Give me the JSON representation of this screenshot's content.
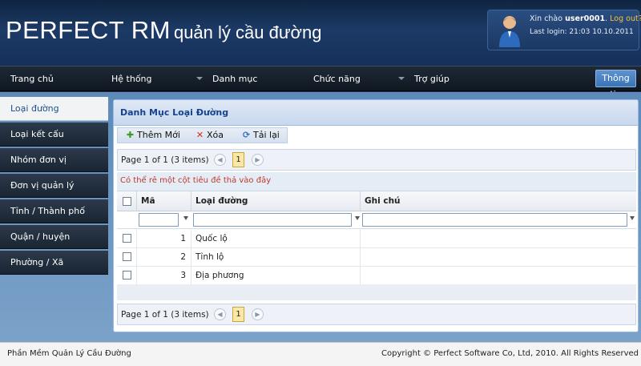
{
  "header": {
    "brand": "PERFECT RM",
    "subtitle": "quản lý cầu đường",
    "greeting": "Xin chào",
    "username": "user0001",
    "separator": ".",
    "logout": "Log out?",
    "last_login": "Last login: 21:03 10.10.2011"
  },
  "nav": {
    "items": [
      {
        "label": "Trang chủ",
        "has_dropdown": false
      },
      {
        "label": "Hệ thống",
        "has_dropdown": true
      },
      {
        "label": "Danh mục",
        "has_dropdown": false
      },
      {
        "label": "Chức năng",
        "has_dropdown": true
      },
      {
        "label": "Trợ giúp",
        "has_dropdown": false
      }
    ],
    "info_button": "Thông tin"
  },
  "sidebar": {
    "items": [
      {
        "label": "Loại đường",
        "active": true
      },
      {
        "label": "Loại kết cấu",
        "active": false
      },
      {
        "label": "Nhóm đơn vị",
        "active": false
      },
      {
        "label": "Đơn vị quản lý",
        "active": false
      },
      {
        "label": "Tỉnh / Thành phố",
        "active": false
      },
      {
        "label": "Quận / huyện",
        "active": false
      },
      {
        "label": "Phường / Xã",
        "active": false
      }
    ]
  },
  "panel": {
    "title": "Danh Mục Loại Đường",
    "toolbar": {
      "add": "Thêm Mới",
      "delete": "Xóa",
      "reload": "Tải lại"
    },
    "pager": {
      "text": "Page 1 of 1 (3 items)",
      "current_page": "1",
      "prev_icon": "chevron-left-icon",
      "next_icon": "chevron-right-icon"
    },
    "group_hint": "Có thể rê một cột tiêu đề thả vào đây",
    "columns": [
      "Mã",
      "Loại đường",
      "Ghi chú"
    ],
    "rows": [
      {
        "id": "1",
        "name": "Quốc lộ",
        "note": ""
      },
      {
        "id": "2",
        "name": "Tỉnh lộ",
        "note": ""
      },
      {
        "id": "3",
        "name": "Địa phương",
        "note": ""
      }
    ]
  },
  "footer": {
    "left": "Phần Mềm Quản Lý Cầu Đường",
    "right": "Copyright © Perfect Software Co, Ltd, 2010. All Rights Reserved"
  },
  "colors": {
    "header_bg": "#1c3a66",
    "nav_bg": "#1a2532",
    "accent_blue": "#15428b",
    "info_button": "#4a82c3",
    "logout_link": "#f3c33a",
    "group_hint_text": "#c0392b",
    "body_bg": "#6a95c0"
  }
}
